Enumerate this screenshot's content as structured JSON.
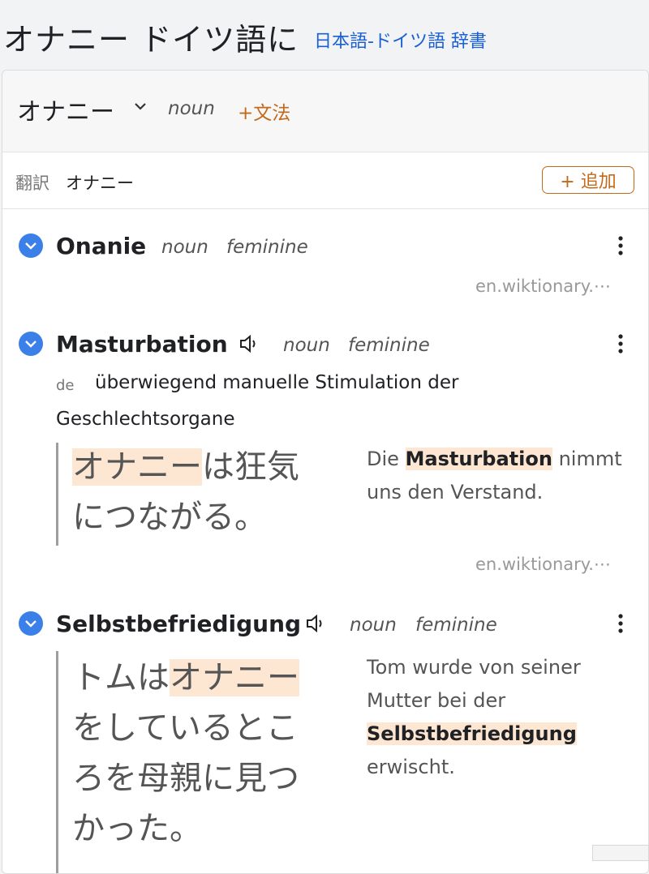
{
  "header": {
    "title": "オナニー ドイツ語に",
    "subtitle": "日本語-ドイツ語 辞書"
  },
  "headword": {
    "term": "オナニー",
    "pos": "noun",
    "grammar_label": "+文法"
  },
  "translations": {
    "label": "翻訳",
    "value": "オナニー",
    "add_button": "+ 追加"
  },
  "entries": [
    {
      "term": "Onanie",
      "pos": "noun",
      "gender": "feminine",
      "source": "en.wiktionary.⋯"
    },
    {
      "term": "Masturbation",
      "pos": "noun",
      "gender": "feminine",
      "def_lang": "de",
      "definition": "überwiegend manuelle Stimulation der Geschlechtsorgane",
      "example_ja_highlight": "オナニー",
      "example_ja_rest": "は狂気につながる。",
      "example_de_pre": "Die ",
      "example_de_highlight": "Masturbation",
      "example_de_post": " nimmt uns den Verstand.",
      "source": "en.wiktionary.⋯"
    },
    {
      "term": "Selbstbefriedigung",
      "pos": "noun",
      "gender": "feminine",
      "example_ja_pre": "トムは",
      "example_ja_highlight": "オナニー",
      "example_ja_rest": "をしているところを母親に見つかった。",
      "example_de_pre": "Tom wurde von seiner Mutter bei der ",
      "example_de_highlight": "Selbstbefriedigung",
      "example_de_post": " erwischt."
    }
  ],
  "icons": {
    "check": "check-icon",
    "speaker": "speaker-icon",
    "more": "more-vertical-icon",
    "chevron": "chevron-down-icon"
  },
  "colors": {
    "accent_blue": "#3a80e8",
    "link_blue": "#1a5fd6",
    "accent_orange": "#c26a1a",
    "highlight": "#fde7d2"
  }
}
